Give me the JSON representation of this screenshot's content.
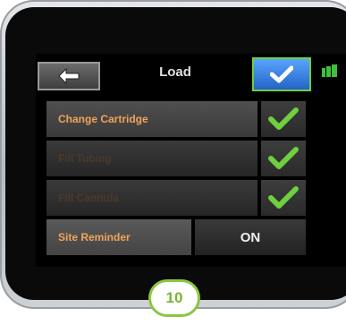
{
  "header": {
    "title": "Load",
    "back_icon": "arrow-left-icon",
    "confirm_icon": "checkmark-icon",
    "battery_icon": "battery-icon"
  },
  "items": [
    {
      "label": "Change Cartridge",
      "done": true,
      "icon": "green-check-icon"
    },
    {
      "label": "Fill Tubing",
      "done": true,
      "icon": "green-check-icon"
    },
    {
      "label": "Fill Cannula",
      "done": true,
      "icon": "green-check-icon"
    }
  ],
  "site_reminder": {
    "label": "Site Reminder",
    "value": "ON"
  },
  "step_badge": "10",
  "colors": {
    "accent_orange": "#f2a35a",
    "check_green": "#6fcf3f",
    "confirm_blue": "#2f79e0"
  }
}
